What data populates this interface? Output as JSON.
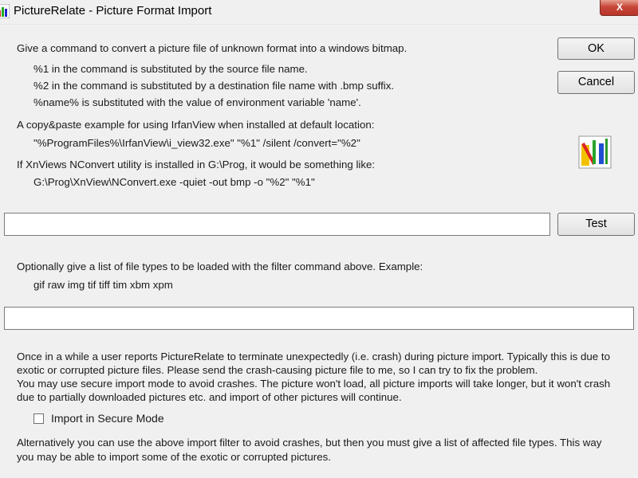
{
  "window": {
    "title": "PictureRelate - Picture Format Import",
    "close_glyph": "X"
  },
  "intro": {
    "line1": "Give a command to convert a picture file of unknown format into a windows bitmap.",
    "sub1": "%1 in the command is substituted by the source file name.",
    "sub2": "%2 in the command is substituted by a destination file name with .bmp suffix.",
    "sub3": "%name% is substituted with the value of environment variable 'name'."
  },
  "examples": {
    "irfan_label": "A copy&paste example for using IrfanView when installed at default location:",
    "irfan_cmd": "\"%ProgramFiles%\\IrfanView\\i_view32.exe\" \"%1\" /silent /convert=\"%2\"",
    "xn_label": "If XnViews NConvert utility is installed in G:\\Prog, it would be something like:",
    "xn_cmd": "G:\\Prog\\XnView\\NConvert.exe -quiet -out bmp -o \"%2\" \"%1\""
  },
  "buttons": {
    "ok": "OK",
    "cancel": "Cancel",
    "test": "Test"
  },
  "command_field": {
    "value": ""
  },
  "filetypes": {
    "label": "Optionally give a list of file types to be loaded with the filter command above. Example:",
    "example": "gif raw img tif tiff tim xbm xpm",
    "value": ""
  },
  "crash_note": {
    "line1": "Once in a while a user reports PictureRelate to terminate unexpectedly (i.e. crash) during picture import. Typically this is due to",
    "line2": "exotic or corrupted picture files. Please send the crash-causing picture file to me, so I can try to fix the problem.",
    "line3": "You may use secure import mode to avoid crashes. The picture won't load, all picture imports will take longer, but it won't crash",
    "line4": "due to partially downloaded pictures etc. and import of other pictures will continue."
  },
  "secure_mode": {
    "label": "Import in Secure Mode",
    "checked": false
  },
  "alternative": {
    "line1": "Alternatively you can use the above import filter to avoid crashes, but then you must give a list of affected file types. This way",
    "line2": "you may be able to import some of the exotic or corrupted pictures."
  },
  "icons": {
    "title_icon": "picturerelate-app-icon",
    "dialog_icon": "picturerelate-chart-icon"
  },
  "colors": {
    "background": "#f0f0f0",
    "close_button": "#c7473a"
  }
}
